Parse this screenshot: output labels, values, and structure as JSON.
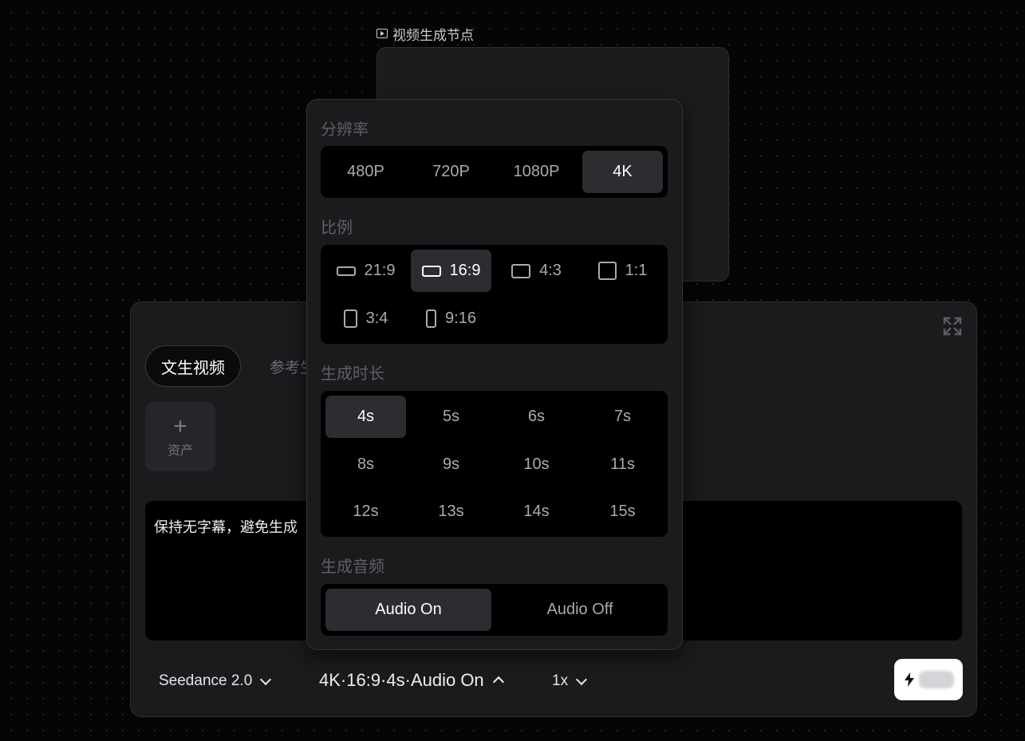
{
  "node": {
    "title": "视频生成节点",
    "title_icon": "play-square-icon"
  },
  "resolution": {
    "label": "分辨率",
    "options": [
      "480P",
      "720P",
      "1080P",
      "4K"
    ],
    "selected": "4K"
  },
  "ratio": {
    "label": "比例",
    "options": [
      "21:9",
      "16:9",
      "4:3",
      "1:1",
      "3:4",
      "9:16"
    ],
    "selected": "16:9"
  },
  "duration": {
    "label": "生成时长",
    "options": [
      "4s",
      "5s",
      "6s",
      "7s",
      "8s",
      "9s",
      "10s",
      "11s",
      "12s",
      "13s",
      "14s",
      "15s"
    ],
    "selected": "4s"
  },
  "audio": {
    "label": "生成音频",
    "options": [
      "Audio On",
      "Audio Off"
    ],
    "selected": "Audio On"
  },
  "tabs": {
    "text_to_video": "文生视频",
    "reference_partial": "参考生"
  },
  "asset": {
    "label": "资产",
    "icon": "plus-icon"
  },
  "prompt": {
    "visible_text": "保持无字幕，避免生成"
  },
  "footer": {
    "model": "Seedance 2.0",
    "params": "4K·16:9·4s·Audio On",
    "speed": "1x"
  },
  "generate": {
    "icon": "lightning-icon"
  },
  "colors": {
    "background": "#050505",
    "panel": "#1b1b1e",
    "selected_option": "#2c2c31",
    "generate_button": "#ffffff"
  }
}
